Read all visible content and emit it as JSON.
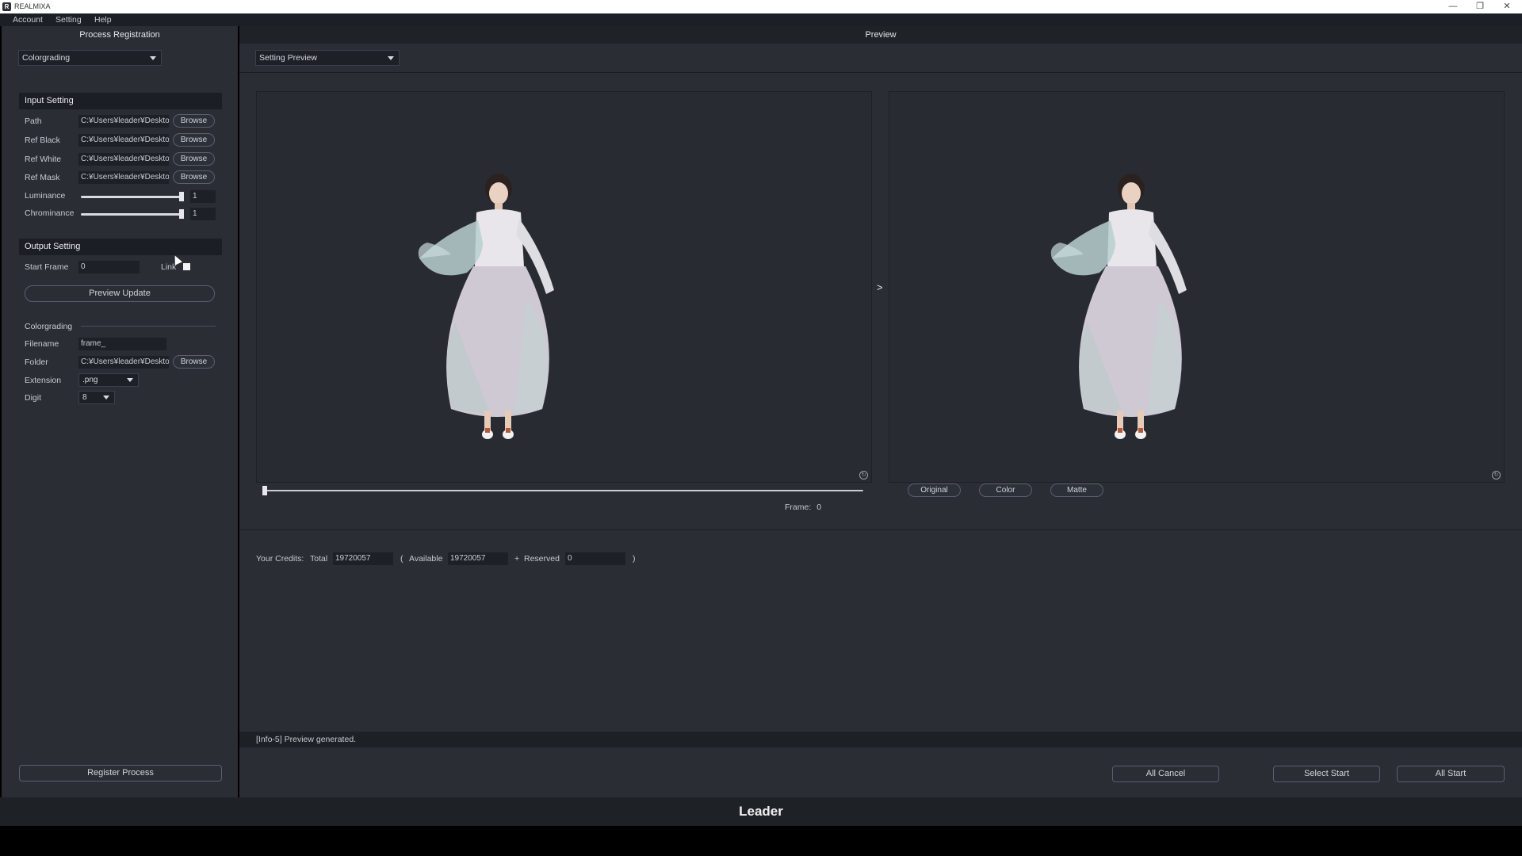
{
  "window": {
    "title": "REALMIXA",
    "minimize": "—",
    "maximize": "❐",
    "close": "✕",
    "app_icon": "R"
  },
  "menu": {
    "items": [
      "Account",
      "Setting",
      "Help"
    ]
  },
  "left": {
    "header": "Process Registration",
    "process_select": "Colorgrading",
    "input_section": "Input Setting",
    "browse_label": "Browse",
    "inputs": [
      {
        "label": "Path",
        "value": "C:¥Users¥leader¥Desktop"
      },
      {
        "label": "Ref Black",
        "value": "C:¥Users¥leader¥Desktop"
      },
      {
        "label": "Ref White",
        "value": "C:¥Users¥leader¥Desktop"
      },
      {
        "label": "Ref Mask",
        "value": "C:¥Users¥leader¥Desktop"
      }
    ],
    "luminance": {
      "label": "Luminance",
      "value": "1",
      "level": 1.0
    },
    "chrominance": {
      "label": "Chrominance",
      "value": "1",
      "level": 1.0
    },
    "output_section": "Output Setting",
    "start_frame": {
      "label": "Start Frame",
      "value": "0"
    },
    "link_label": "Link",
    "preview_update": "Preview Update",
    "colorgrading_label": "Colorgrading",
    "filename": {
      "label": "Filename",
      "value": "frame_"
    },
    "folder": {
      "label": "Folder",
      "value": "C:¥Users¥leader¥Desktop"
    },
    "extension": {
      "label": "Extension",
      "value": ".png"
    },
    "digit": {
      "label": "Digit",
      "value": "8"
    },
    "register": "Register Process"
  },
  "right": {
    "header": "Preview",
    "preview_select": "Setting Preview",
    "arrow": ">",
    "frame_label": "Frame:",
    "frame_value": "0",
    "frame_position": 0.0,
    "view_buttons": [
      "Original",
      "Color",
      "Matte"
    ]
  },
  "credits": {
    "label": "Your Credits:",
    "total_label": "Total",
    "total": "19720057",
    "open_paren": "(",
    "available_label": "Available",
    "available": "19720057",
    "plus": "+",
    "reserved_label": "Reserved",
    "reserved": "0",
    "close_paren": ")"
  },
  "status": "[Info-5] Preview generated.",
  "actions": {
    "all_cancel": "All Cancel",
    "select_start": "Select Start",
    "all_start": "All Start"
  },
  "footer": "Leader"
}
